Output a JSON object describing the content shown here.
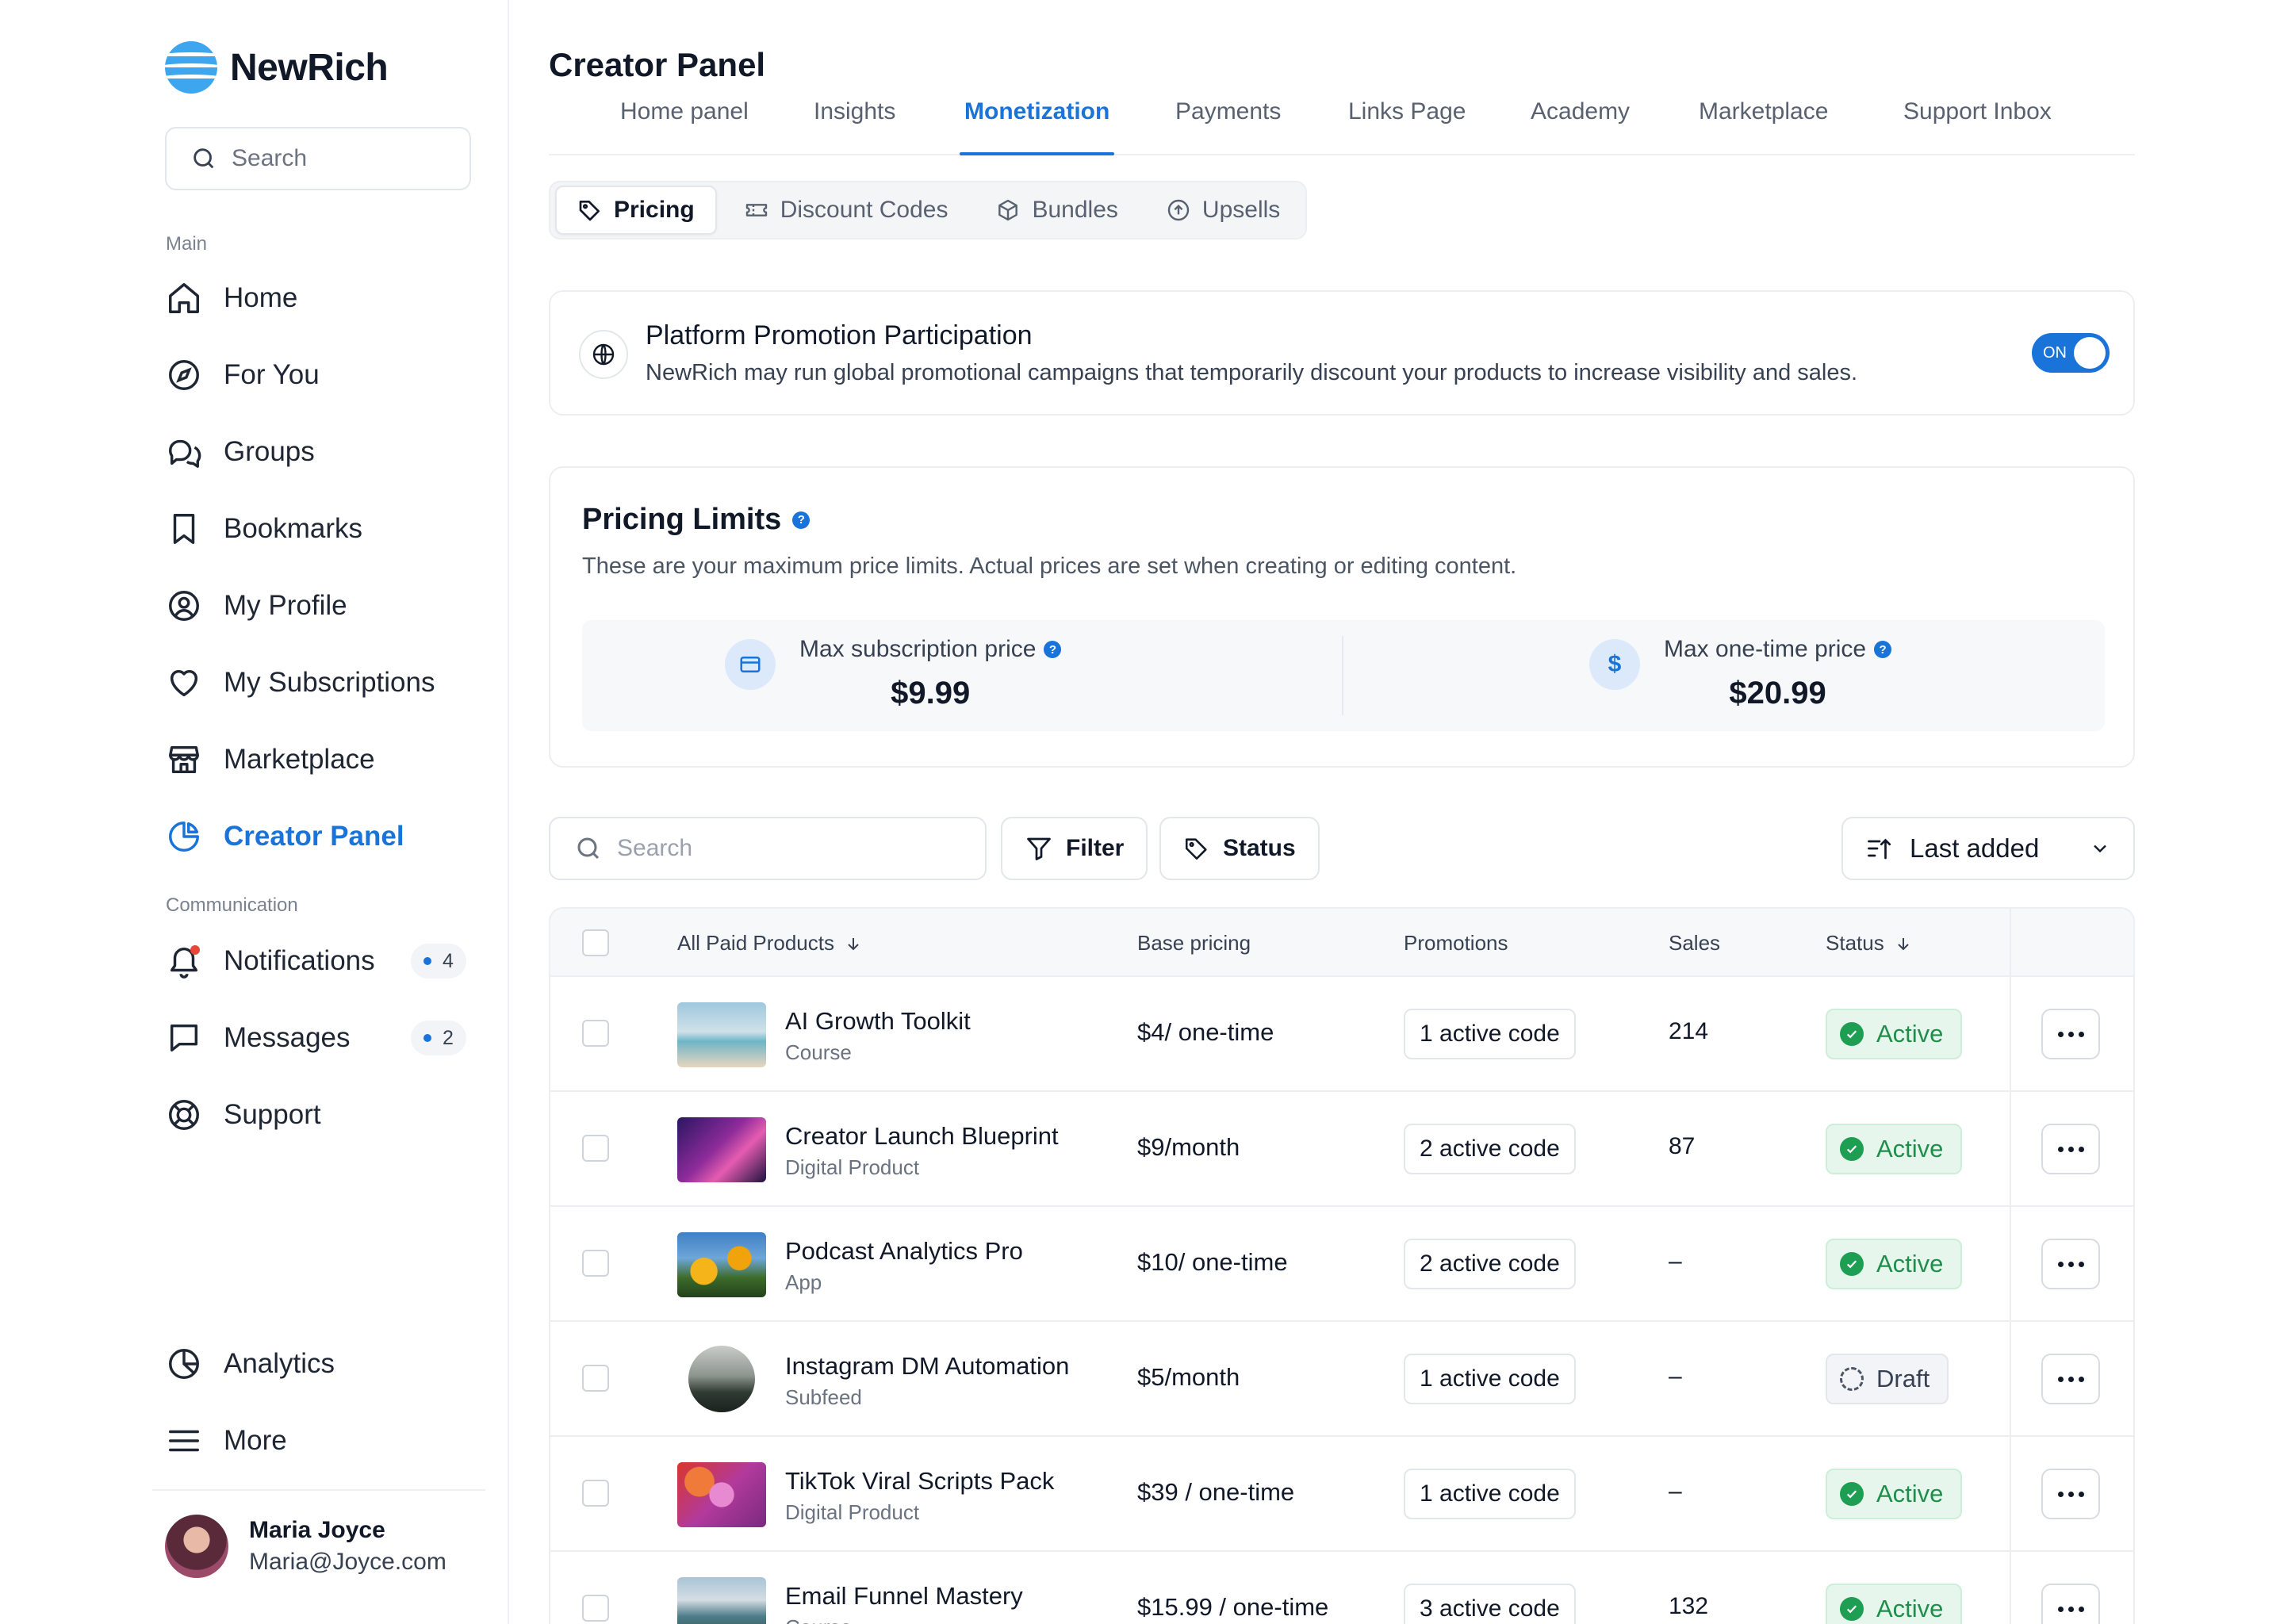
{
  "app": {
    "name": "NewRich"
  },
  "sidebar": {
    "search_placeholder": "Search",
    "section_main": "Main",
    "section_communication": "Communication",
    "items": [
      {
        "label": "Home",
        "icon": "home-icon"
      },
      {
        "label": "For You",
        "icon": "compass-icon"
      },
      {
        "label": "Groups",
        "icon": "chat-bubbles-icon"
      },
      {
        "label": "Bookmarks",
        "icon": "bookmark-icon"
      },
      {
        "label": "My Profile",
        "icon": "user-circle-icon"
      },
      {
        "label": "My Subscriptions",
        "icon": "heart-icon"
      },
      {
        "label": "Marketplace",
        "icon": "store-icon"
      },
      {
        "label": "Creator Panel",
        "icon": "pie-chart-icon",
        "active": true
      }
    ],
    "comm_items": [
      {
        "label": "Notifications",
        "icon": "bell-icon",
        "count": "4"
      },
      {
        "label": "Messages",
        "icon": "message-icon",
        "count": "2"
      },
      {
        "label": "Support",
        "icon": "lifebuoy-icon"
      }
    ],
    "bottom_items": [
      {
        "label": "Analytics",
        "icon": "chart-pie-icon"
      },
      {
        "label": "More",
        "icon": "menu-icon"
      }
    ],
    "user": {
      "name": "Maria Joyce",
      "email": "Maria@Joyce.com"
    }
  },
  "header": {
    "title": "Creator Panel",
    "tabs": [
      "Home panel",
      "Insights",
      "Monetization",
      "Payments",
      "Links Page",
      "Academy",
      "Marketplace",
      "Support Inbox"
    ],
    "active_tab": "Monetization"
  },
  "subtabs": [
    "Pricing",
    "Discount Codes",
    "Bundles",
    "Upsells"
  ],
  "promotion": {
    "title": "Platform Promotion Participation",
    "description": "NewRich may run global promotional campaigns that temporarily discount your products to increase visibility and sales.",
    "toggle_label": "ON"
  },
  "limits": {
    "title": "Pricing Limits",
    "description": "These are your maximum price limits. Actual prices are set when creating or editing content.",
    "subscription_label": "Max subscription price",
    "subscription_value": "$9.99",
    "onetime_label": "Max one-time price",
    "onetime_value": "$20.99",
    "onetime_icon": "$"
  },
  "toolbar": {
    "search_placeholder": "Search",
    "filter_label": "Filter",
    "status_label": "Status",
    "sort_label": "Last added"
  },
  "table": {
    "headers": {
      "product": "All Paid Products",
      "pricing": "Base pricing",
      "promotions": "Promotions",
      "sales": "Sales",
      "status": "Status"
    },
    "rows": [
      {
        "name": "AI Growth Toolkit",
        "type": "Course",
        "price": "$4/ one-time",
        "promo": "1 active code",
        "sales": "214",
        "status": "Active"
      },
      {
        "name": "Creator Launch Blueprint",
        "type": "Digital Product",
        "price": "$9/month",
        "promo": "2 active code",
        "sales": "87",
        "status": "Active"
      },
      {
        "name": "Podcast Analytics Pro",
        "type": "App",
        "price": "$10/ one-time",
        "promo": "2 active code",
        "sales": "–",
        "status": "Active"
      },
      {
        "name": "Instagram DM Automation",
        "type": "Subfeed",
        "price": "$5/month",
        "promo": "1 active code",
        "sales": "–",
        "status": "Draft"
      },
      {
        "name": "TikTok Viral Scripts Pack",
        "type": "Digital Product",
        "price": "$39 / one-time",
        "promo": "1 active code",
        "sales": "–",
        "status": "Active"
      },
      {
        "name": "Email Funnel Mastery",
        "type": "Course",
        "price": "$15.99 / one-time",
        "promo": "3 active code",
        "sales": "132",
        "status": "Active"
      }
    ]
  },
  "colors": {
    "accent": "#1a73d9",
    "active_green": "#1e8e4a",
    "logo": "#3ea6ee"
  }
}
